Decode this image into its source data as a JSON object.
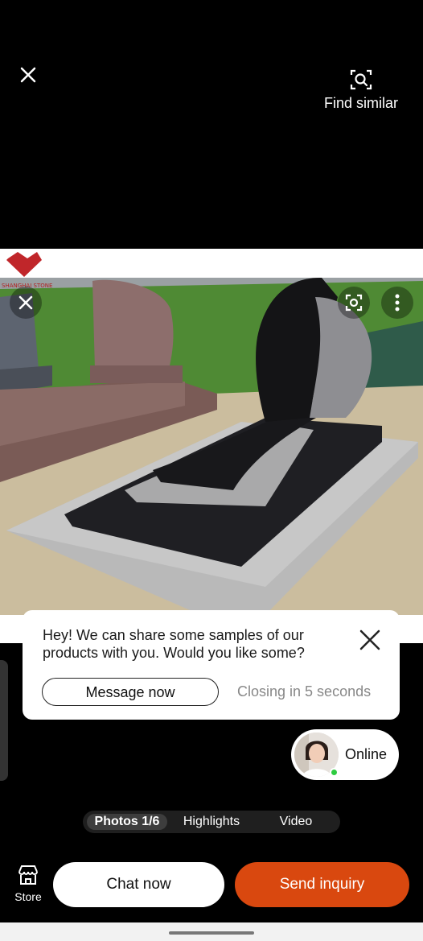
{
  "header": {
    "find_similar_label": "Find similar"
  },
  "photo": {
    "watermark": "SHANGHAI STONE"
  },
  "popup": {
    "message": "Hey! We can share some samples of our products with you. Would you like some?",
    "message_button": "Message now",
    "countdown": "Closing in 5 seconds"
  },
  "online": {
    "label": "Online",
    "status_color": "#2ecc40"
  },
  "media_tabs": [
    {
      "label": "Photos 1/6",
      "active": true
    },
    {
      "label": "Highlights",
      "active": false
    },
    {
      "label": "Video",
      "active": false
    }
  ],
  "bottom_bar": {
    "store_label": "Store",
    "chat_label": "Chat now",
    "inquiry_label": "Send inquiry",
    "inquiry_color": "#d9480f"
  }
}
